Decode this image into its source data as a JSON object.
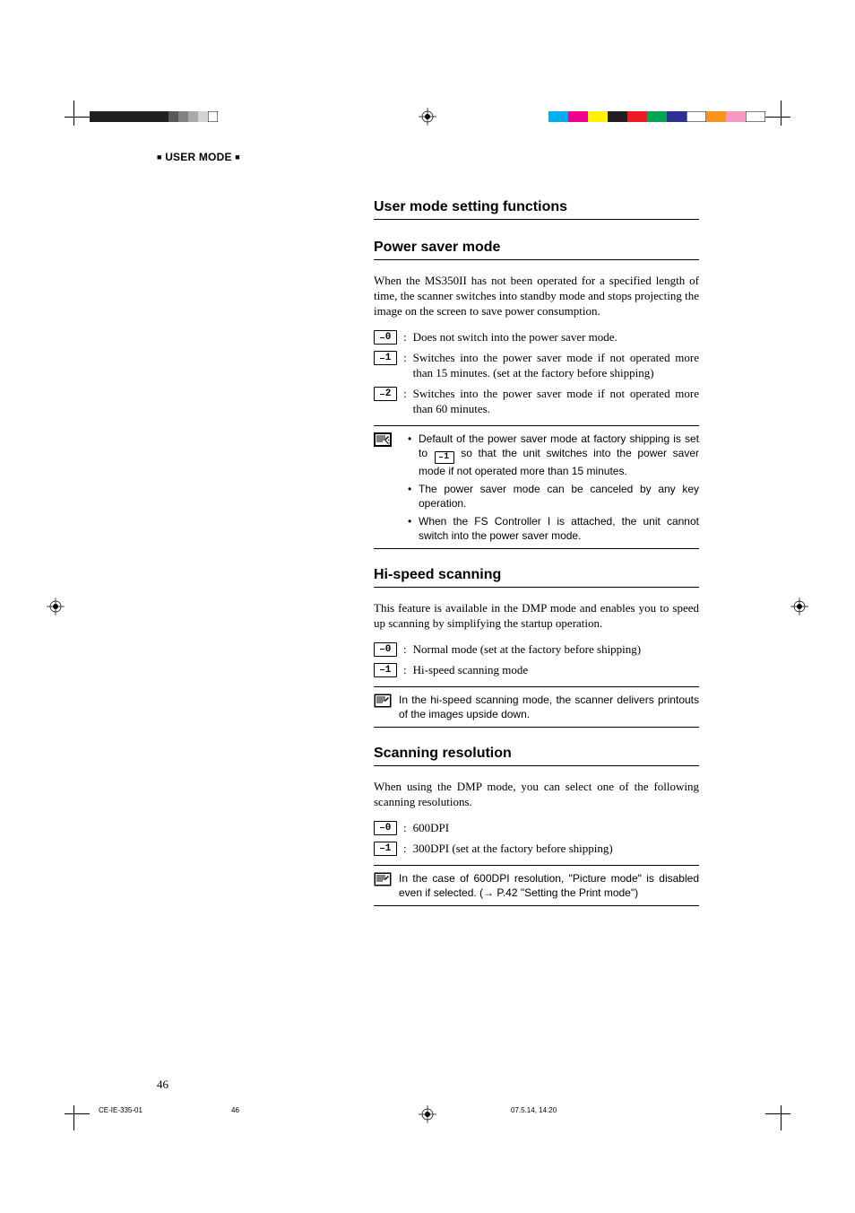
{
  "header": {
    "label": "USER MODE"
  },
  "title": "User mode setting functions",
  "sections": {
    "power": {
      "heading": "Power saver mode",
      "intro": "When the MS350II has not been operated for a specified length of time, the scanner switches into standby mode and stops projecting the image on the screen to save power consumption.",
      "opts": [
        {
          "code": "0",
          "text": "Does not switch into the power saver mode."
        },
        {
          "code": "1",
          "text": "Switches into the power saver mode if not operated more than 15 minutes. (set at the factory before shipping)"
        },
        {
          "code": "2",
          "text": "Switches into the power saver mode if not operated more than 60 minutes."
        }
      ],
      "note": {
        "bullets": [
          {
            "pre": "Default of the power saver mode at factory shipping is set to ",
            "code": "1",
            "post": " so that the unit switches into the power saver mode if not operated more than 15 minutes."
          },
          {
            "text": "The power saver mode can be canceled by any key operation."
          },
          {
            "text": "When the FS Controller I is attached, the unit cannot switch into the power saver mode."
          }
        ]
      }
    },
    "hispeed": {
      "heading": "Hi-speed scanning",
      "intro": "This feature is available in the DMP mode and enables you to speed up scanning by simplifying the startup operation.",
      "opts": [
        {
          "code": "0",
          "text": "Normal mode (set at the factory before shipping)"
        },
        {
          "code": "1",
          "text": "Hi-speed scanning mode"
        }
      ],
      "note": {
        "text": "In the hi-speed scanning mode, the scanner delivers printouts of the images upside down."
      }
    },
    "resolution": {
      "heading": "Scanning resolution",
      "intro": "When using the DMP mode, you can select one of the following scanning resolutions.",
      "opts": [
        {
          "code": "0",
          "text": "600DPI"
        },
        {
          "code": "1",
          "text": "300DPI (set at the factory before shipping)"
        }
      ],
      "note": {
        "text": "In the case of 600DPI resolution, \"Picture mode\" is  disabled even if selected. (→ P.42 \"Setting the Print mode\")"
      }
    }
  },
  "pageNumber": "46",
  "footer": {
    "left": "CE-IE-335-01",
    "mid": "46",
    "right": "07.5.14, 14:20"
  },
  "colors": {
    "left_bars": [
      "#231f20",
      "#231f20",
      "#231f20",
      "#231f20",
      "#58595b",
      "#808285",
      "#a7a9ac",
      "#d1d3d4",
      "#ffffff"
    ],
    "right_bars": [
      "#00aeef",
      "#ec008c",
      "#fff200",
      "#231f20",
      "#ed1c24",
      "#00a651",
      "#2e3192",
      "#ffffff",
      "#f7941d",
      "#f49ac1",
      "#ffffff"
    ]
  }
}
